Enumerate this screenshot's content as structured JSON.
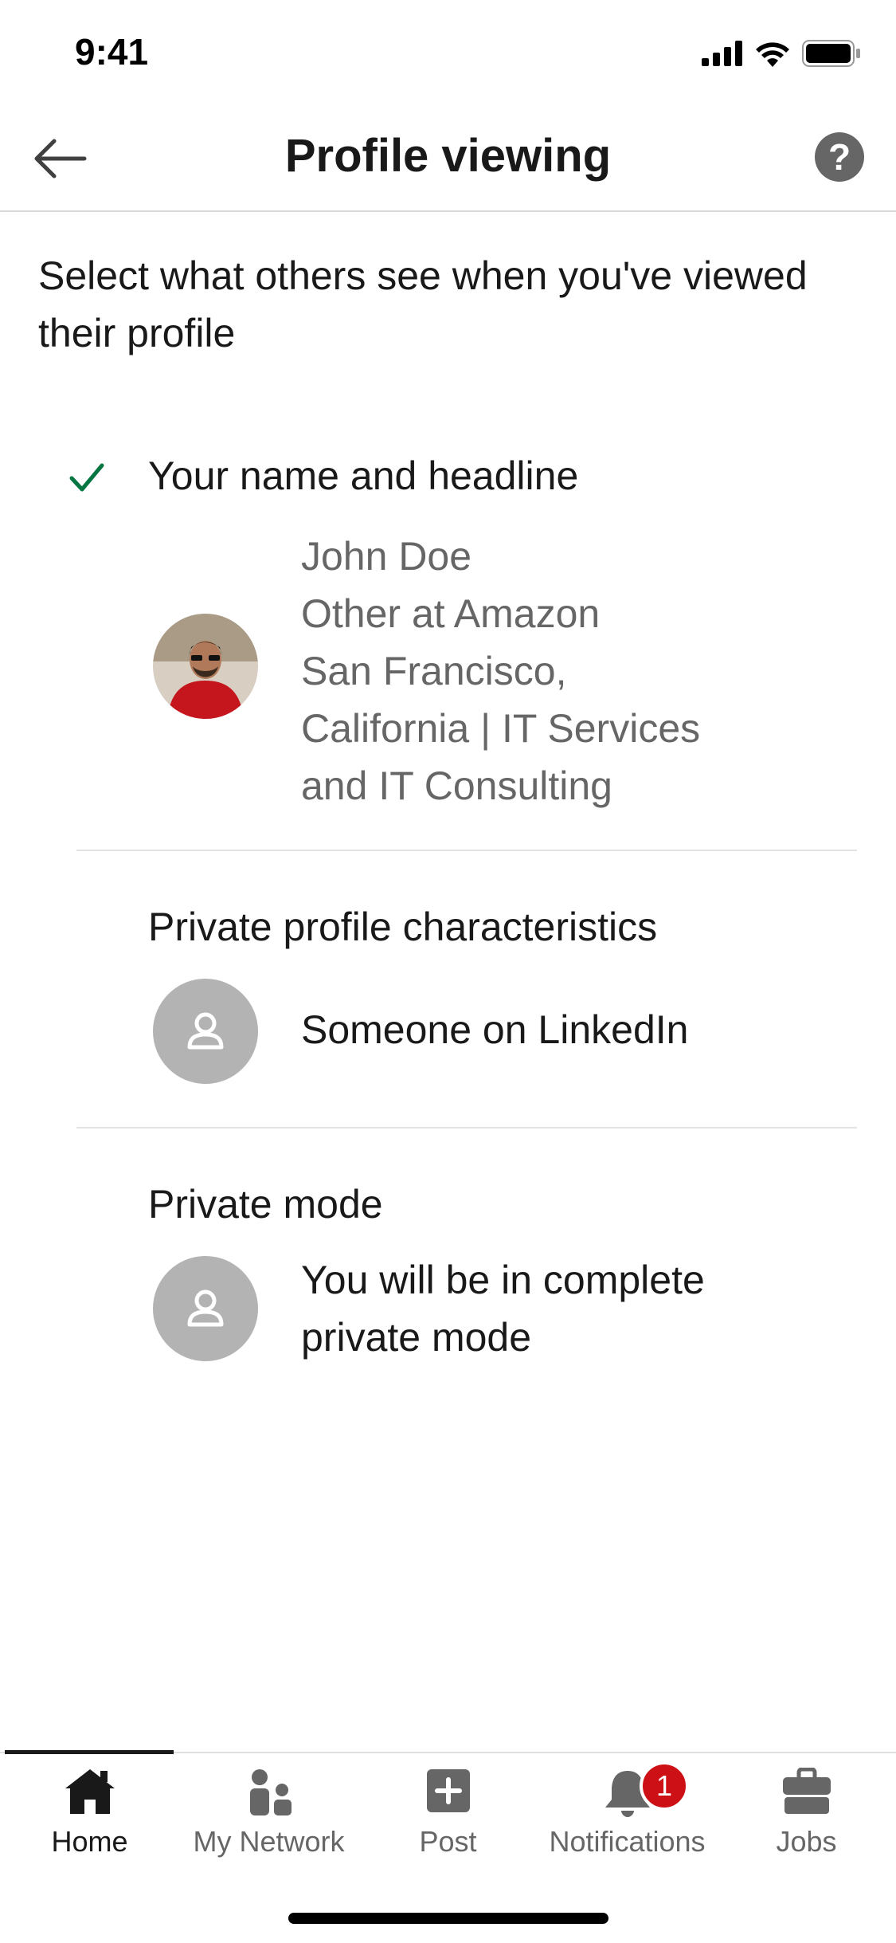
{
  "status_bar": {
    "time": "9:41"
  },
  "header": {
    "title": "Profile viewing"
  },
  "intro_text": "Select what others see when you've viewed their profile",
  "options": [
    {
      "label": "Your name and headline",
      "selected": true,
      "details": [
        "John Doe",
        "Other at Amazon",
        "San Francisco,",
        "California | IT Services",
        "and IT Consulting"
      ]
    },
    {
      "label": "Private profile characteristics",
      "selected": false,
      "details": [
        "Someone on LinkedIn"
      ]
    },
    {
      "label": "Private mode",
      "selected": false,
      "details": [
        "You will be in complete",
        "private mode"
      ]
    }
  ],
  "nav": {
    "items": [
      {
        "label": "Home",
        "icon": "home-icon",
        "active": true
      },
      {
        "label": "My Network",
        "icon": "network-icon",
        "active": false
      },
      {
        "label": "Post",
        "icon": "post-icon",
        "active": false
      },
      {
        "label": "Notifications",
        "icon": "bell-icon",
        "active": false,
        "badge": "1"
      },
      {
        "label": "Jobs",
        "icon": "briefcase-icon",
        "active": false
      }
    ]
  },
  "colors": {
    "check": "#057642",
    "badge": "#cc1016",
    "gray_text": "#666666"
  }
}
